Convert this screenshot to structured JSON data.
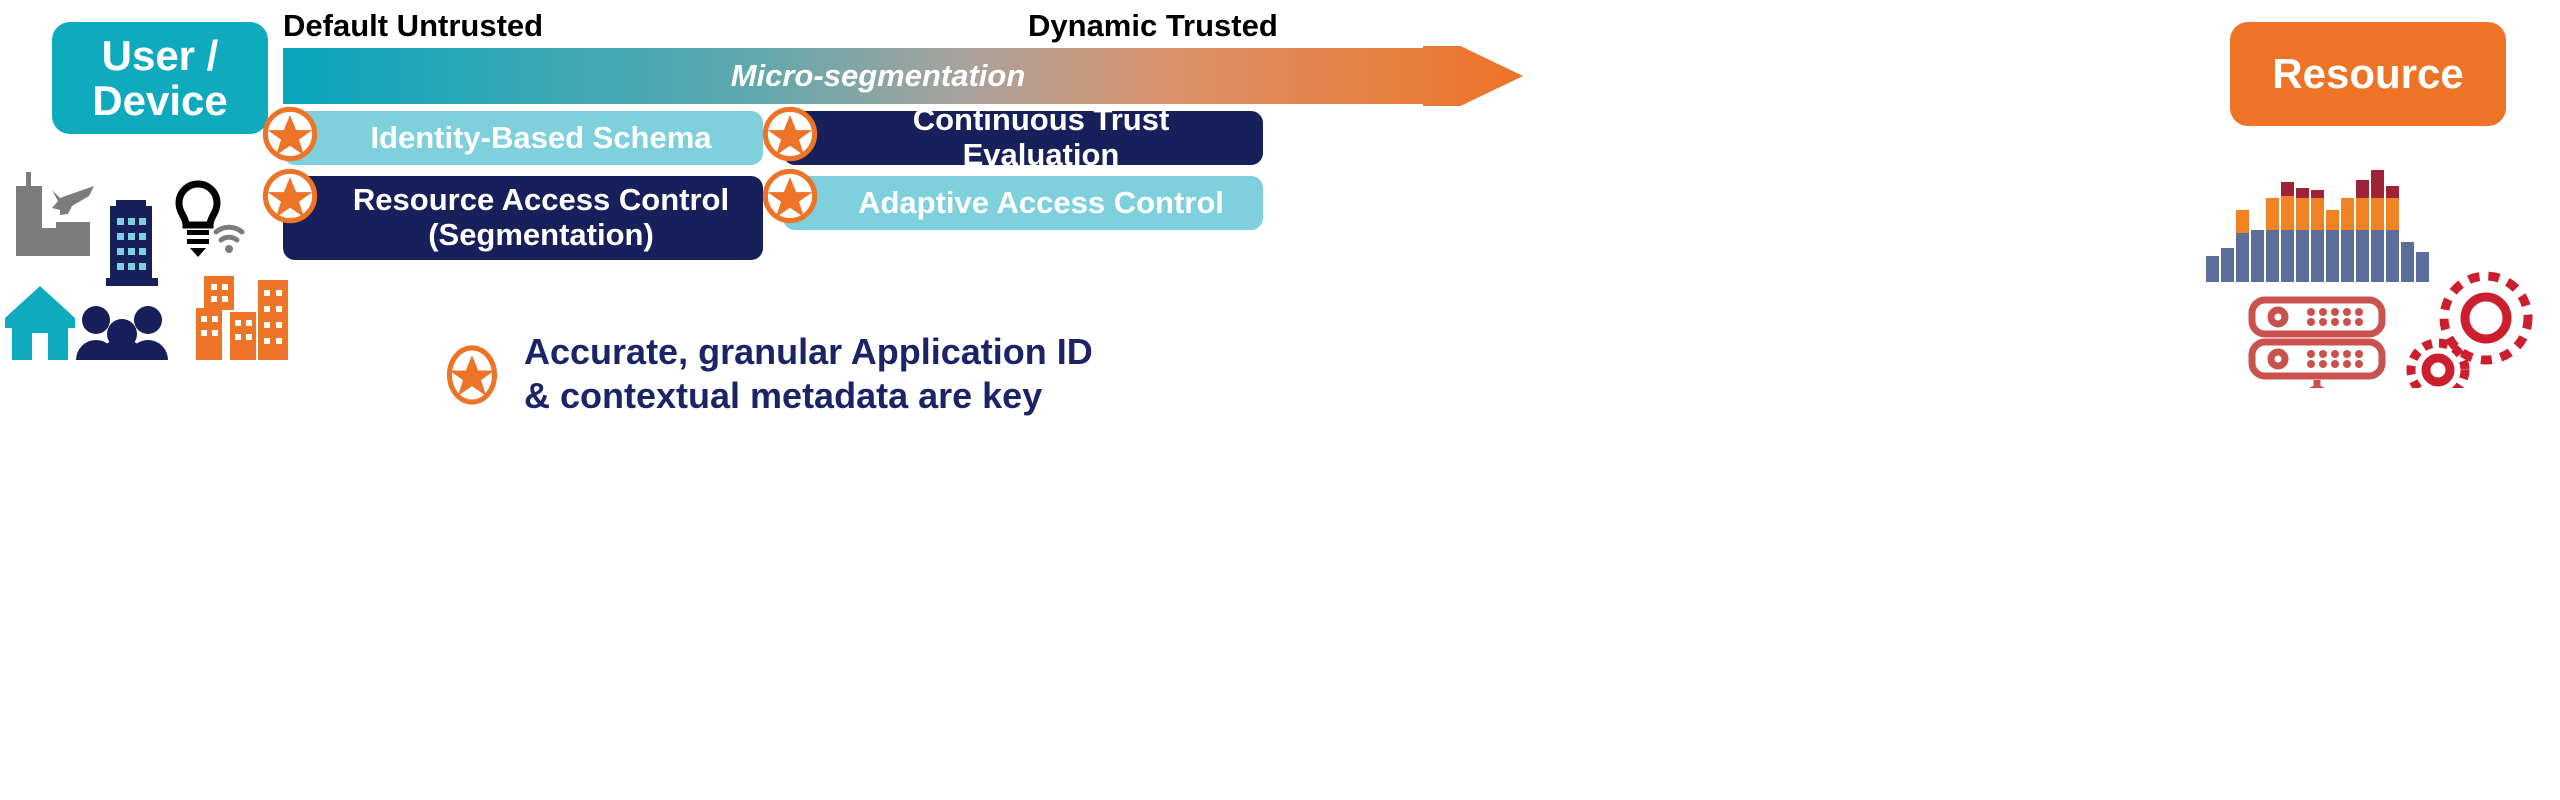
{
  "endpoints": {
    "source": {
      "label": "User /\nDevice",
      "color": "#10AABF",
      "name": "user-device"
    },
    "target": {
      "label": "Resource",
      "color": "#ED7326",
      "name": "resource"
    }
  },
  "axis": {
    "left_label": "Default Untrusted",
    "right_label": "Dynamic Trusted",
    "arrow_label": "Micro-segmentation",
    "gradient_from": "#08A6BC",
    "gradient_to": "#ED7326"
  },
  "bars": [
    {
      "id": "identity",
      "label": "Identity-Based Schema",
      "style": "lightteal",
      "row": 1,
      "col": "left"
    },
    {
      "id": "continuous",
      "label": "Continuous Trust Evaluation",
      "style": "navy",
      "row": 1,
      "col": "right"
    },
    {
      "id": "resource-access",
      "label": "Resource Access Control\n(Segmentation)",
      "style": "navy",
      "row": 2,
      "col": "left"
    },
    {
      "id": "adaptive",
      "label": "Adaptive Access Control",
      "style": "lightteal",
      "row": 2,
      "col": "right"
    }
  ],
  "footnote": {
    "text": "Accurate, granular Application ID\n& contextual metadata are key",
    "color": "#1B2466"
  },
  "badges": {
    "icon": "star-badge-icon",
    "ring_color": "#ED7326",
    "fill_color": "#FFFFFF",
    "star_color": "#ED7326"
  },
  "left_icons": [
    {
      "name": "factory-airplane-icon",
      "color": "#7C7C7C"
    },
    {
      "name": "office-building-icon",
      "color": "#17205A"
    },
    {
      "name": "lightbulb-wifi-icon",
      "color": "#000000"
    },
    {
      "name": "house-icon",
      "color": "#10AABF"
    },
    {
      "name": "people-group-icon",
      "color": "#17205A"
    },
    {
      "name": "city-buildings-icon",
      "color": "#ED7326"
    }
  ],
  "right_icons": [
    {
      "name": "bar-chart-icon",
      "colors": [
        "#5C6E9C",
        "#F28322",
        "#9E2336"
      ]
    },
    {
      "name": "server-rack-icon",
      "color": "#C9524F"
    },
    {
      "name": "gears-icon",
      "color": "#CC1F2E"
    }
  ],
  "palette": {
    "teal": "#10AABF",
    "light_teal": "#7DD0DC",
    "navy": "#17205A",
    "orange": "#ED7326",
    "white": "#FFFFFF",
    "black": "#000000"
  }
}
